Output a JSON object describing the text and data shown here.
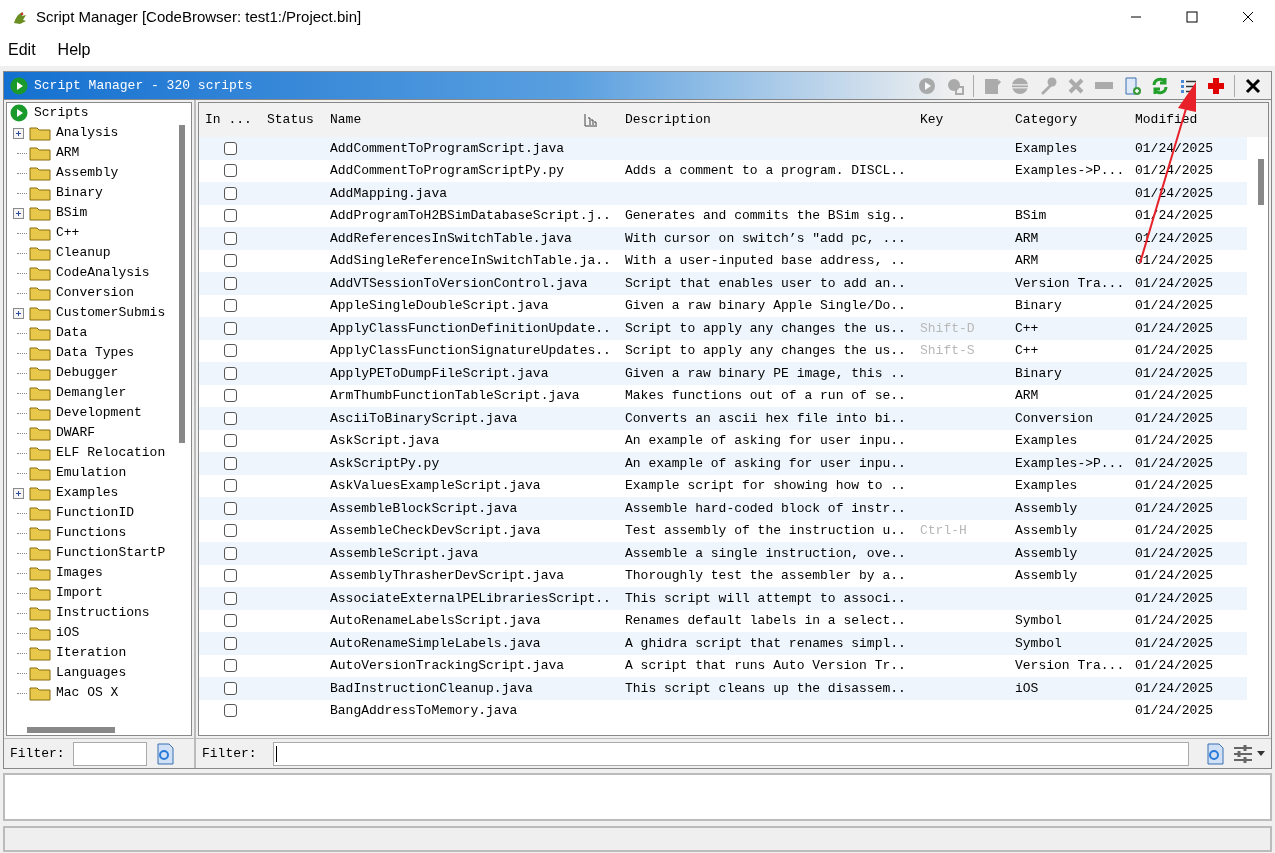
{
  "window": {
    "title": "Script Manager [CodeBrowser: test1:/Project.bin]"
  },
  "menu": [
    "Edit",
    "Help"
  ],
  "panel": {
    "title": "Script Manager - 320 scripts"
  },
  "toolbar": [
    {
      "kind": "run",
      "disabled": true
    },
    {
      "kind": "run-again",
      "disabled": true
    },
    {
      "kind": "edit",
      "disabled": true
    },
    {
      "kind": "eclipse",
      "disabled": true
    },
    {
      "kind": "key",
      "disabled": true
    },
    {
      "kind": "delete",
      "disabled": true
    },
    {
      "kind": "rename",
      "disabled": true
    },
    {
      "kind": "new",
      "disabled": false
    },
    {
      "kind": "refresh",
      "disabled": false
    },
    {
      "kind": "list",
      "disabled": false
    },
    {
      "kind": "add",
      "disabled": false
    },
    {
      "kind": "close",
      "disabled": false
    }
  ],
  "tree": {
    "root": "Scripts",
    "children": [
      {
        "label": "Analysis",
        "kind": "branch"
      },
      {
        "label": "ARM",
        "kind": "leaf"
      },
      {
        "label": "Assembly",
        "kind": "leaf"
      },
      {
        "label": "Binary",
        "kind": "leaf"
      },
      {
        "label": "BSim",
        "kind": "branch"
      },
      {
        "label": "C++",
        "kind": "leaf"
      },
      {
        "label": "Cleanup",
        "kind": "leaf"
      },
      {
        "label": "CodeAnalysis",
        "kind": "leaf"
      },
      {
        "label": "Conversion",
        "kind": "leaf"
      },
      {
        "label": "CustomerSubmis",
        "kind": "branch"
      },
      {
        "label": "Data",
        "kind": "leaf"
      },
      {
        "label": "Data Types",
        "kind": "leaf"
      },
      {
        "label": "Debugger",
        "kind": "leaf"
      },
      {
        "label": "Demangler",
        "kind": "leaf"
      },
      {
        "label": "Development",
        "kind": "leaf"
      },
      {
        "label": "DWARF",
        "kind": "leaf"
      },
      {
        "label": "ELF Relocation",
        "kind": "leaf"
      },
      {
        "label": "Emulation",
        "kind": "leaf"
      },
      {
        "label": "Examples",
        "kind": "branch"
      },
      {
        "label": "FunctionID",
        "kind": "leaf"
      },
      {
        "label": "Functions",
        "kind": "leaf"
      },
      {
        "label": "FunctionStartP",
        "kind": "leaf"
      },
      {
        "label": "Images",
        "kind": "leaf"
      },
      {
        "label": "Import",
        "kind": "leaf"
      },
      {
        "label": "Instructions",
        "kind": "leaf"
      },
      {
        "label": "iOS",
        "kind": "leaf"
      },
      {
        "label": "Iteration",
        "kind": "leaf"
      },
      {
        "label": "Languages",
        "kind": "leaf"
      },
      {
        "label": "Mac OS X",
        "kind": "leaf"
      }
    ]
  },
  "tree_filter": {
    "label": "Filter:"
  },
  "table": {
    "columns": [
      "In ...",
      "Status",
      "Name",
      "Description",
      "Key",
      "Category",
      "Modified"
    ],
    "rows": [
      {
        "checked": false,
        "name": "AddCommentToProgramScript.java",
        "description": "",
        "key": "",
        "category": "Examples",
        "modified": "01/24/2025"
      },
      {
        "checked": false,
        "name": "AddCommentToProgramScriptPy.py",
        "description": "Adds a comment to a program. DISCL..",
        "key": "",
        "category": "Examples->P...",
        "modified": "01/24/2025"
      },
      {
        "checked": false,
        "name": "AddMapping.java",
        "description": "",
        "key": "",
        "category": "",
        "modified": "01/24/2025"
      },
      {
        "checked": false,
        "name": "AddProgramToH2BSimDatabaseScript.j..",
        "description": "Generates and commits the BSim sig..",
        "key": "",
        "category": "BSim",
        "modified": "01/24/2025"
      },
      {
        "checked": false,
        "name": "AddReferencesInSwitchTable.java",
        "description": "With cursor on switch’s ″add pc, ...",
        "key": "",
        "category": "ARM",
        "modified": "01/24/2025"
      },
      {
        "checked": false,
        "name": "AddSingleReferenceInSwitchTable.ja..",
        "description": "With a user-inputed base address, ..",
        "key": "",
        "category": "ARM",
        "modified": "01/24/2025"
      },
      {
        "checked": false,
        "name": "AddVTSessionToVersionControl.java",
        "description": "Script that enables user to add an..",
        "key": "",
        "category": "Version Tra...",
        "modified": "01/24/2025"
      },
      {
        "checked": false,
        "name": "AppleSingleDoubleScript.java",
        "description": "Given a raw binary Apple Single/Do..",
        "key": "",
        "category": "Binary",
        "modified": "01/24/2025"
      },
      {
        "checked": false,
        "name": "ApplyClassFunctionDefinitionUpdate..",
        "description": "Script to apply any changes the us..",
        "key": "Shift-D",
        "category": "C++",
        "modified": "01/24/2025"
      },
      {
        "checked": false,
        "name": "ApplyClassFunctionSignatureUpdates..",
        "description": "Script to apply any changes the us..",
        "key": "Shift-S",
        "category": "C++",
        "modified": "01/24/2025"
      },
      {
        "checked": false,
        "name": "ApplyPEToDumpFileScript.java",
        "description": "Given a raw binary PE image, this ..",
        "key": "",
        "category": "Binary",
        "modified": "01/24/2025"
      },
      {
        "checked": false,
        "name": "ArmThumbFunctionTableScript.java",
        "description": "Makes functions out of a run of se..",
        "key": "",
        "category": "ARM",
        "modified": "01/24/2025"
      },
      {
        "checked": false,
        "name": "AsciiToBinaryScript.java",
        "description": "Converts an ascii hex file into bi..",
        "key": "",
        "category": "Conversion",
        "modified": "01/24/2025"
      },
      {
        "checked": false,
        "name": "AskScript.java",
        "description": "An example of asking for user inpu..",
        "key": "",
        "category": "Examples",
        "modified": "01/24/2025"
      },
      {
        "checked": false,
        "name": "AskScriptPy.py",
        "description": "An example of asking for user inpu..",
        "key": "",
        "category": "Examples->P...",
        "modified": "01/24/2025"
      },
      {
        "checked": false,
        "name": "AskValuesExampleScript.java",
        "description": "Example script for showing how to ..",
        "key": "",
        "category": "Examples",
        "modified": "01/24/2025"
      },
      {
        "checked": false,
        "name": "AssembleBlockScript.java",
        "description": "Assemble hard-coded block of instr..",
        "key": "",
        "category": "Assembly",
        "modified": "01/24/2025"
      },
      {
        "checked": false,
        "name": "AssembleCheckDevScript.java",
        "description": "Test assembly of the instruction u..",
        "key": "Ctrl-H",
        "category": "Assembly",
        "modified": "01/24/2025"
      },
      {
        "checked": false,
        "name": "AssembleScript.java",
        "description": "Assemble a single instruction, ove..",
        "key": "",
        "category": "Assembly",
        "modified": "01/24/2025"
      },
      {
        "checked": false,
        "name": "AssemblyThrasherDevScript.java",
        "description": "Thoroughly test the assembler by a..",
        "key": "",
        "category": "Assembly",
        "modified": "01/24/2025"
      },
      {
        "checked": false,
        "name": "AssociateExternalPELibrariesScript..",
        "description": "This script will attempt to associ..",
        "key": "",
        "category": "",
        "modified": "01/24/2025"
      },
      {
        "checked": false,
        "name": "AutoRenameLabelsScript.java",
        "description": "Renames default labels in a select..",
        "key": "",
        "category": "Symbol",
        "modified": "01/24/2025"
      },
      {
        "checked": false,
        "name": "AutoRenameSimpleLabels.java",
        "description": "A ghidra script that renames simpl..",
        "key": "",
        "category": "Symbol",
        "modified": "01/24/2025"
      },
      {
        "checked": false,
        "name": "AutoVersionTrackingScript.java",
        "description": "A script that runs Auto Version Tr..",
        "key": "",
        "category": "Version Tra...",
        "modified": "01/24/2025"
      },
      {
        "checked": false,
        "name": "BadInstructionCleanup.java",
        "description": "This script cleans up the disassem..",
        "key": "",
        "category": "iOS",
        "modified": "01/24/2025"
      },
      {
        "checked": false,
        "name": "BangAddressToMemory.java",
        "description": "",
        "key": "",
        "category": "",
        "modified": "01/24/2025"
      }
    ]
  },
  "table_filter": {
    "label": "Filter:"
  }
}
